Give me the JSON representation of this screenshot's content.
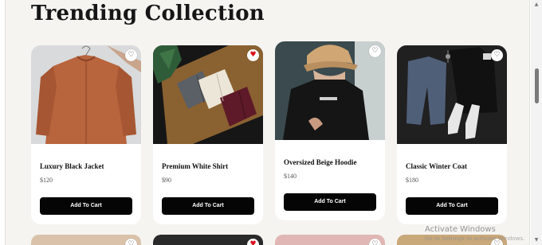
{
  "section": {
    "title": "Trending Collection"
  },
  "products": [
    {
      "name": "Luxury Black Jacket",
      "price": "$120",
      "button": "Add To Cart",
      "favorite": "♡",
      "favorited": false
    },
    {
      "name": "Premium White Shirt",
      "price": "$90",
      "button": "Add To Cart",
      "favorite": "♥",
      "favorited": true
    },
    {
      "name": "Oversized Beige Hoodie",
      "price": "$140",
      "button": "Add To Cart",
      "favorite": "♡",
      "favorited": false
    },
    {
      "name": "Classic Winter Coat",
      "price": "$180",
      "button": "Add To Cart",
      "favorite": "♡",
      "favorited": false
    }
  ],
  "row2": {
    "favorites": [
      "♡",
      "♥",
      "♡",
      "♡"
    ]
  },
  "watermark": {
    "title": "Activate Windows",
    "subtitle": "Go to Settings to activate Windows."
  },
  "scrollbar": {
    "up": "▲",
    "down": "▼"
  },
  "colors": {
    "background": "#f5f4f1",
    "card": "#ffffff",
    "button": "#050505",
    "favorite_active": "#d8121d"
  }
}
